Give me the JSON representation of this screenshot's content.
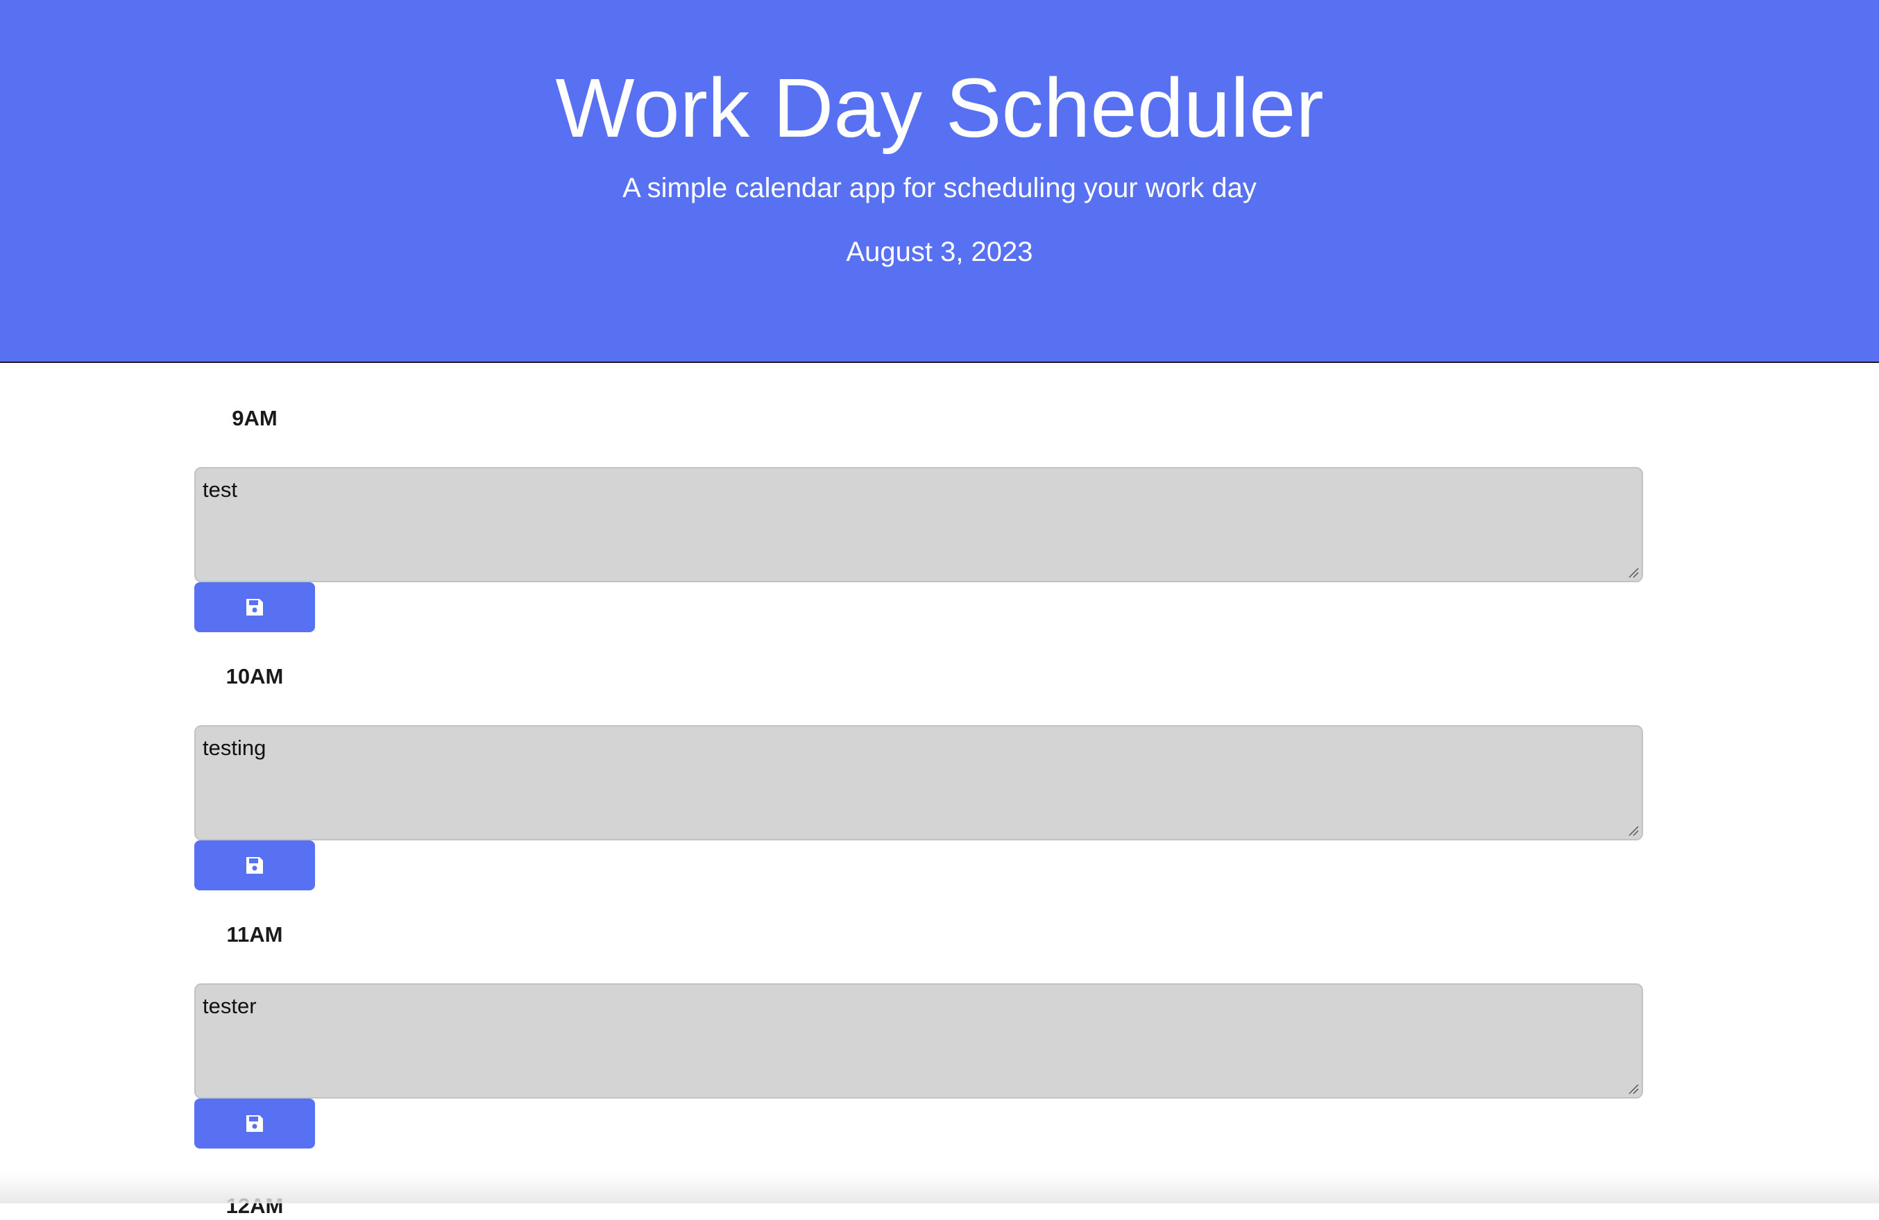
{
  "header": {
    "title": "Work Day Scheduler",
    "subtitle": "A simple calendar app for scheduling your work day",
    "current_date": "August 3, 2023"
  },
  "colors": {
    "primary": "#5870F2",
    "textarea_bg": "#d4d4d4",
    "header_text": "#ffffff"
  },
  "time_blocks": [
    {
      "hour": "9AM",
      "note": "test",
      "save_icon": "floppy-disk-icon"
    },
    {
      "hour": "10AM",
      "note": "testing",
      "save_icon": "floppy-disk-icon"
    },
    {
      "hour": "11AM",
      "note": "tester",
      "save_icon": "floppy-disk-icon"
    }
  ],
  "next_hour_partial": "12AM"
}
